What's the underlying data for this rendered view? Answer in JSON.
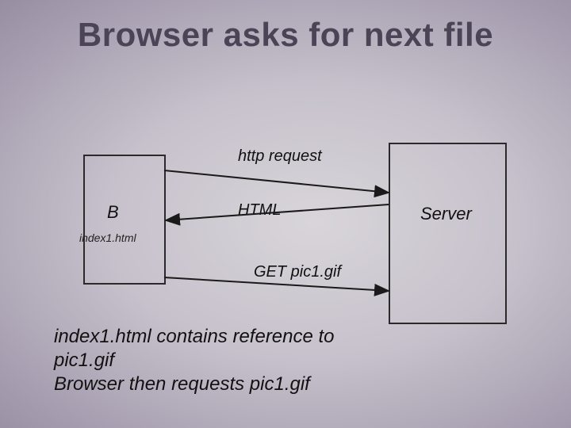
{
  "title": "Browser asks for next file",
  "browser_label": "B",
  "server_label": "Server",
  "browser_file": "index1.html",
  "arrows": {
    "http_request": "http request",
    "html": "HTML",
    "get": "GET pic1.gif"
  },
  "caption": "index1.html contains reference to pic1.gif\nBrowser then requests  pic1.gif"
}
